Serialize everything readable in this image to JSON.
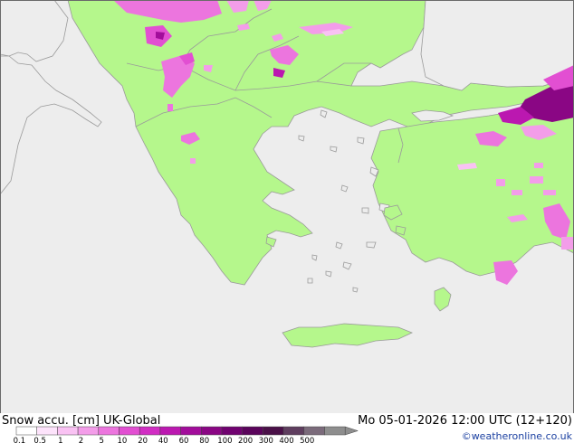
{
  "title_left": "Snow accu. [cm] UK-Global",
  "title_right": "Mo 05-01-2026 12:00 UTC (12+120)",
  "credit": "©weatheronline.co.uk",
  "legend": {
    "ticks": [
      "0.1",
      "0.5",
      "1",
      "2",
      "5",
      "10",
      "20",
      "40",
      "60",
      "80",
      "100",
      "200",
      "300",
      "400",
      "500"
    ],
    "colors": [
      "#ffffff",
      "#fde3fb",
      "#f9c2f3",
      "#f39de9",
      "#ec75de",
      "#e24fd2",
      "#d12dc3",
      "#bb18b0",
      "#a20d9b",
      "#8a0684",
      "#700270",
      "#5a045b",
      "#4a1048",
      "#5f3e5f",
      "#7b6b7b",
      "#8e8e8e"
    ]
  },
  "map_colors": {
    "sea": "#ededed",
    "land": "#b5f78c",
    "outside_land": "#ededed",
    "border": "#9a9a9a"
  }
}
